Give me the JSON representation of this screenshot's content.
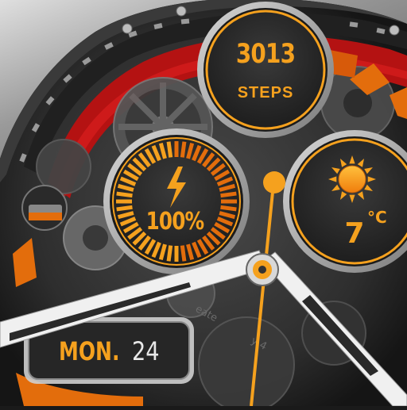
{
  "watch_face": {
    "steps": {
      "value": "3013",
      "label": "STEPS"
    },
    "battery": {
      "value": "100%",
      "level_percent": 100,
      "icon": "lightning-bolt-icon"
    },
    "weather": {
      "temperature": "7",
      "unit": "°C",
      "icon": "sun-icon"
    },
    "date": {
      "weekday": "MON.",
      "day": "24"
    },
    "colors": {
      "accent": "#f5a11e",
      "accent_dark": "#e36d0c",
      "bezel_red": "#c01414",
      "hand_white": "#f0f0f0",
      "gauge_bg": "#2b2b2b"
    }
  }
}
